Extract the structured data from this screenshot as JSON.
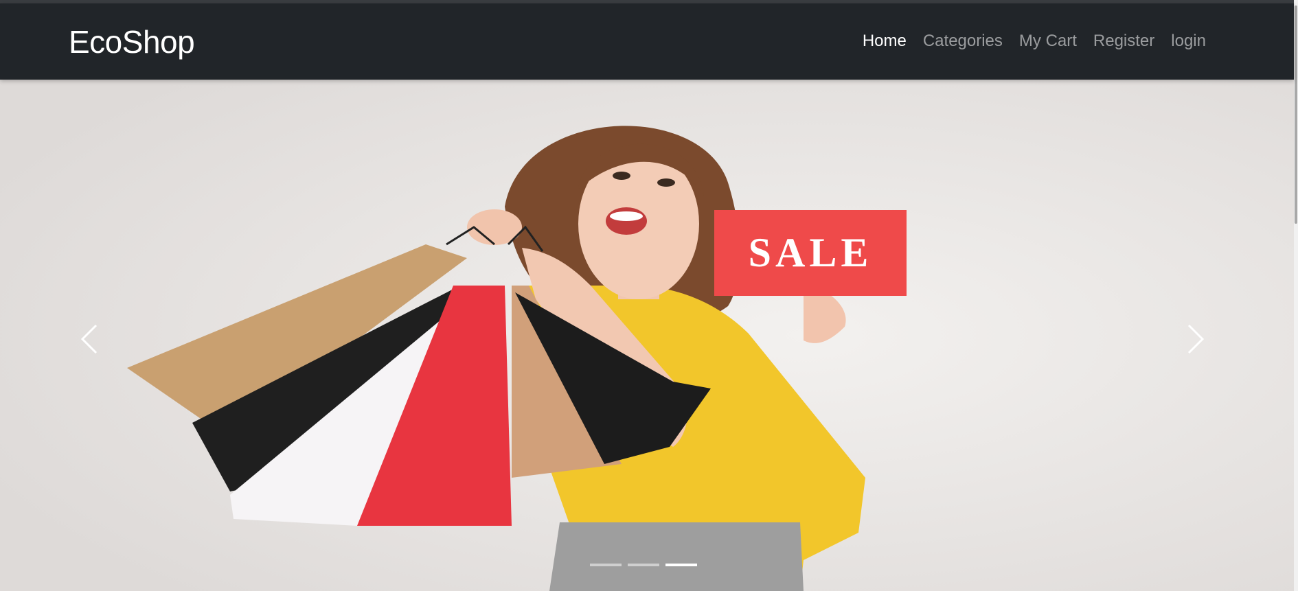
{
  "brand": {
    "name": "EcoShop"
  },
  "nav": {
    "home": "Home",
    "categories": "Categories",
    "cart": "My Cart",
    "register": "Register",
    "login": "login"
  },
  "carousel": {
    "sign_text": "SALE",
    "slide_count": 3,
    "active_slide": 3,
    "prev_icon": "chevron-left-icon",
    "next_icon": "chevron-right-icon"
  },
  "colors": {
    "navbar_bg": "#212529",
    "nav_active": "#ffffff",
    "nav_inactive": "rgba(255,255,255,0.55)",
    "shirt": "#f2c62b",
    "sale_sign": "#ef4a4a"
  }
}
